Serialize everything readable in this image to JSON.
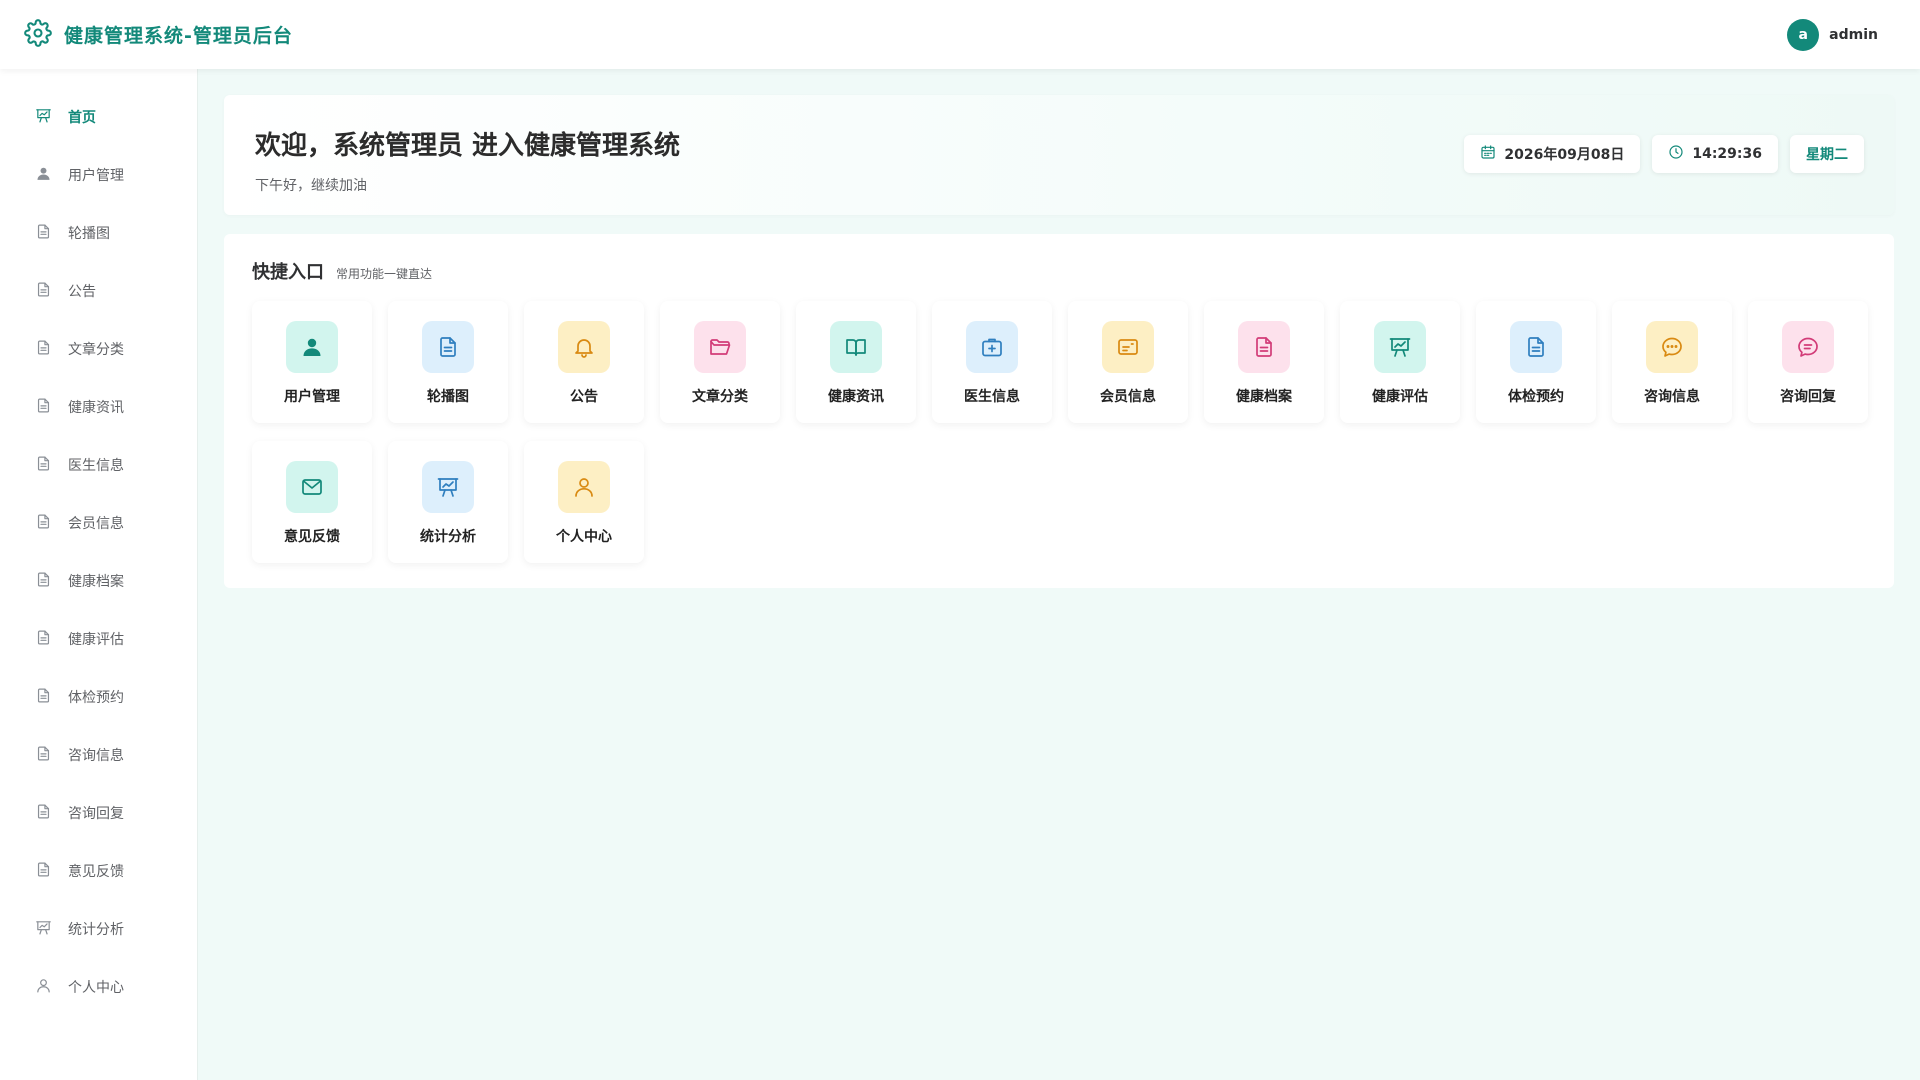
{
  "header": {
    "title": "健康管理系统-管理员后台",
    "avatar_letter": "a",
    "username": "admin",
    "brand_icon": "gear-icon"
  },
  "colors": {
    "primary": "#13897a",
    "teal_bg": "#d2f5ee",
    "teal_fg": "#13897a",
    "blue_bg": "#ddeffc",
    "blue_fg": "#2f7fbf",
    "yellow_bg": "#fdefc4",
    "yellow_fg": "#d98a12",
    "pink_bg": "#fde1ec",
    "pink_fg": "#d23c78"
  },
  "sidebar": {
    "items": [
      {
        "label": "首页",
        "icon": "presentation-icon",
        "active": true
      },
      {
        "label": "用户管理",
        "icon": "user-icon"
      },
      {
        "label": "轮播图",
        "icon": "document-icon"
      },
      {
        "label": "公告",
        "icon": "document-icon"
      },
      {
        "label": "文章分类",
        "icon": "document-icon"
      },
      {
        "label": "健康资讯",
        "icon": "document-icon"
      },
      {
        "label": "医生信息",
        "icon": "document-icon"
      },
      {
        "label": "会员信息",
        "icon": "document-icon"
      },
      {
        "label": "健康档案",
        "icon": "document-icon"
      },
      {
        "label": "健康评估",
        "icon": "document-icon"
      },
      {
        "label": "体检预约",
        "icon": "document-icon"
      },
      {
        "label": "咨询信息",
        "icon": "document-icon"
      },
      {
        "label": "咨询回复",
        "icon": "document-icon"
      },
      {
        "label": "意见反馈",
        "icon": "document-icon"
      },
      {
        "label": "统计分析",
        "icon": "presentation-icon"
      },
      {
        "label": "个人中心",
        "icon": "user-outline-icon"
      }
    ]
  },
  "welcome": {
    "title": "欢迎，系统管理员 进入健康管理系统",
    "subtitle": "下午好，继续加油",
    "date": "2026年09月08日",
    "time": "14:29:36",
    "weekday": "星期二"
  },
  "quick": {
    "title": "快捷入口",
    "subtitle": "常用功能一键直达",
    "cards": [
      {
        "label": "用户管理",
        "icon": "user-icon",
        "theme": "teal"
      },
      {
        "label": "轮播图",
        "icon": "document-icon",
        "theme": "blue"
      },
      {
        "label": "公告",
        "icon": "bell-icon",
        "theme": "yellow"
      },
      {
        "label": "文章分类",
        "icon": "folder-icon",
        "theme": "pink"
      },
      {
        "label": "健康资讯",
        "icon": "book-icon",
        "theme": "teal"
      },
      {
        "label": "医生信息",
        "icon": "first-aid-icon",
        "theme": "blue"
      },
      {
        "label": "会员信息",
        "icon": "card-icon",
        "theme": "yellow"
      },
      {
        "label": "健康档案",
        "icon": "document-icon",
        "theme": "pink"
      },
      {
        "label": "健康评估",
        "icon": "presentation-icon",
        "theme": "teal"
      },
      {
        "label": "体检预约",
        "icon": "document-icon",
        "theme": "blue"
      },
      {
        "label": "咨询信息",
        "icon": "chat-dots-icon",
        "theme": "yellow"
      },
      {
        "label": "咨询回复",
        "icon": "chat-lines-icon",
        "theme": "pink"
      },
      {
        "label": "意见反馈",
        "icon": "mail-icon",
        "theme": "teal"
      },
      {
        "label": "统计分析",
        "icon": "presentation-icon",
        "theme": "blue"
      },
      {
        "label": "个人中心",
        "icon": "user-outline-icon",
        "theme": "yellow"
      }
    ]
  }
}
